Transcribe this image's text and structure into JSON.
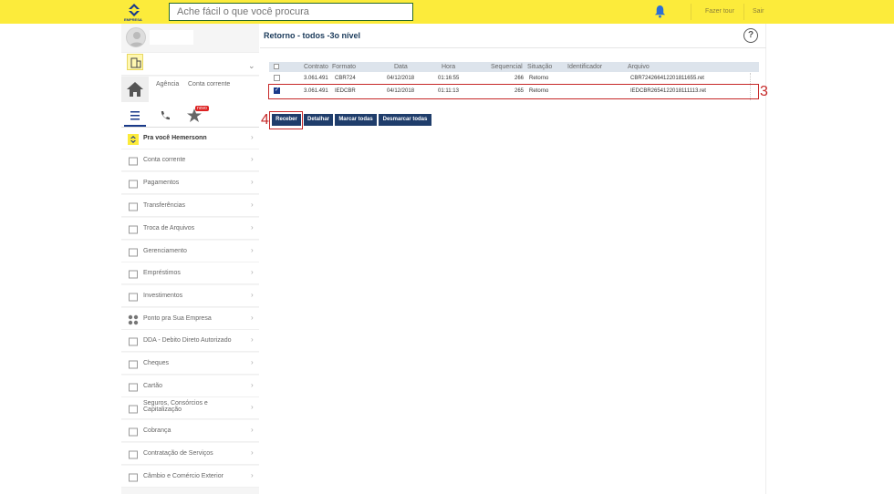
{
  "header": {
    "logo_text": "EMPRESA",
    "search_placeholder": "Ache fácil o que você procura",
    "links": [
      "Fazer tour",
      "Sair"
    ]
  },
  "sidebar": {
    "home_links": [
      "Agência",
      "Conta corrente"
    ],
    "new_badge": "novo",
    "items": [
      {
        "label": "Pra você Hemersonn",
        "icon": "bb-icon",
        "bold": true
      },
      {
        "label": "Conta corrente",
        "icon": "account-icon"
      },
      {
        "label": "Pagamentos",
        "icon": "payment-icon"
      },
      {
        "label": "Transferências",
        "icon": "transfer-icon"
      },
      {
        "label": "Troca de Arquivos",
        "icon": "file-exchange-icon"
      },
      {
        "label": "Gerenciamento",
        "icon": "management-icon"
      },
      {
        "label": "Empréstimos",
        "icon": "loan-icon"
      },
      {
        "label": "Investimentos",
        "icon": "investment-icon"
      },
      {
        "label": "Ponto pra Sua Empresa",
        "icon": "dots-icon"
      },
      {
        "label": "DDA - Debito Direto Autorizado",
        "icon": "dda-icon"
      },
      {
        "label": "Cheques",
        "icon": "check-icon"
      },
      {
        "label": "Cartão",
        "icon": "card-icon"
      },
      {
        "label": "Seguros, Consórcios e Capitalização",
        "icon": "insurance-icon"
      },
      {
        "label": "Cobrança",
        "icon": "billing-icon"
      },
      {
        "label": "Contratação de Serviços",
        "icon": "services-icon"
      },
      {
        "label": "Câmbio e Comércio Exterior",
        "icon": "exchange-icon"
      }
    ]
  },
  "main": {
    "title": "Retorno - todos -3o nível",
    "table": {
      "headers": [
        "Contrato",
        "Formato",
        "Data",
        "Hora",
        "Sequencial",
        "Situação",
        "Identificador",
        "Arquivo"
      ],
      "rows": [
        {
          "checked": false,
          "contrato": "3.061.491",
          "formato": "CBR724",
          "data": "04/12/2018",
          "hora": "01:16:55",
          "sequencial": "266",
          "situacao": "Retorno",
          "identificador": "",
          "arquivo": "CBR724266412201811655.ret"
        },
        {
          "checked": true,
          "contrato": "3.061.491",
          "formato": "IEDCBR",
          "data": "04/12/2018",
          "hora": "01:11:13",
          "sequencial": "265",
          "situacao": "Retorno",
          "identificador": "",
          "arquivo": "IEDCBR2654122018111113.ret"
        }
      ]
    },
    "buttons": [
      "Receber",
      "Detalhar",
      "Marcar todas",
      "Desmarcar todas"
    ],
    "annotations": [
      "3",
      "4"
    ]
  }
}
